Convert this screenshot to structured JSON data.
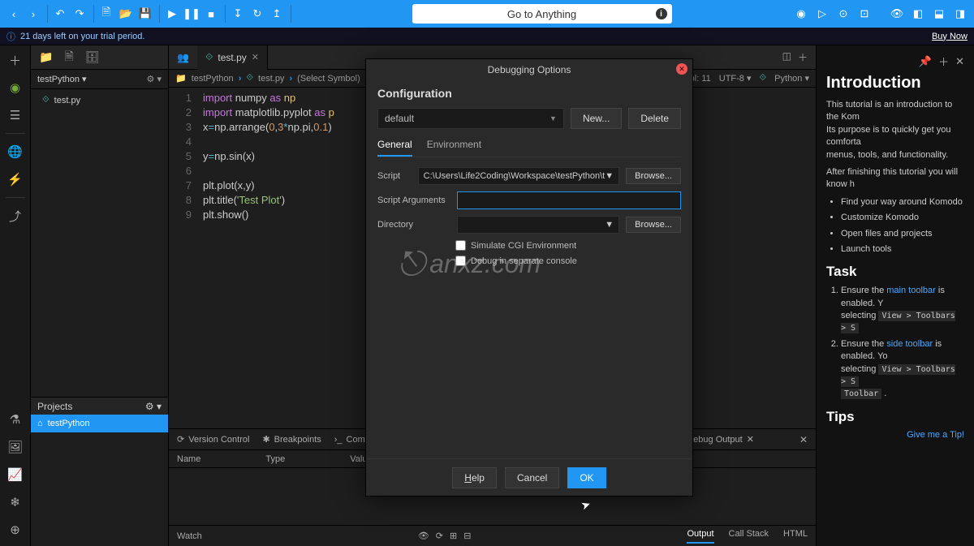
{
  "toolbar": {
    "goto_placeholder": "Go to Anything"
  },
  "trial": {
    "message": "21 days left on your trial period.",
    "buy": "Buy Now"
  },
  "projects": {
    "combo_label": "testPython",
    "tree_item": "test.py",
    "panel_title": "Projects",
    "active_project": "testPython"
  },
  "editor": {
    "tab_label": "test.py",
    "breadcrumb": {
      "folder": "testPython",
      "file": "test.py",
      "symbol": "(Select Symbol)"
    },
    "status": {
      "col": "ol: 11",
      "encoding": "UTF-8",
      "lang": "Python"
    },
    "lines": [
      "1",
      "2",
      "3",
      "4",
      "5",
      "6",
      "7",
      "8",
      "9"
    ],
    "code": [
      {
        "t": "import ",
        "c": "kw"
      },
      {
        "t": "numpy ",
        "c": ""
      },
      {
        "t": "as ",
        "c": "kw"
      },
      {
        "t": "np",
        "c": "mod"
      },
      {
        "br": 1
      },
      {
        "t": "import ",
        "c": "kw"
      },
      {
        "t": "matplotlib.pyplot ",
        "c": ""
      },
      {
        "t": "as ",
        "c": "kw"
      },
      {
        "t": "p",
        "c": "mod"
      },
      {
        "br": 1
      },
      {
        "t": "x",
        "c": ""
      },
      {
        "t": "=",
        "c": "op"
      },
      {
        "t": "np.arrange(",
        "c": ""
      },
      {
        "t": "0",
        "c": "num"
      },
      {
        "t": ",",
        "c": ""
      },
      {
        "t": "3",
        "c": "num"
      },
      {
        "t": "*",
        "c": "op"
      },
      {
        "t": "np.pi,",
        "c": ""
      },
      {
        "t": "0.1",
        "c": "num"
      },
      {
        "t": ")",
        "c": ""
      },
      {
        "br": 1
      },
      {
        "br": 1
      },
      {
        "t": "y",
        "c": ""
      },
      {
        "t": "=",
        "c": "op"
      },
      {
        "t": "np.sin(x)",
        "c": ""
      },
      {
        "br": 1
      },
      {
        "br": 1
      },
      {
        "t": "plt.plot(x,y)",
        "c": ""
      },
      {
        "br": 1
      },
      {
        "t": "plt.title(",
        "c": ""
      },
      {
        "t": "'Test Plot'",
        "c": "str"
      },
      {
        "t": ")",
        "c": ""
      },
      {
        "br": 1
      },
      {
        "t": "plt.show()",
        "c": ""
      }
    ]
  },
  "bottom": {
    "tabs": {
      "vc": "Version Control",
      "bp": "Breakpoints",
      "cmd": "Comma",
      "debug_out": "Debug Output"
    },
    "cols": {
      "name": "Name",
      "type": "Type",
      "value": "Value"
    },
    "watch": "Watch",
    "dtabs": {
      "output": "Output",
      "callstack": "Call Stack",
      "html": "HTML"
    }
  },
  "intro": {
    "h1": "Introduction",
    "p1": "This tutorial is an introduction to the Kom",
    "p1b": "Its purpose is to quickly get you comforta",
    "p1c": "menus, tools, and functionality.",
    "p2": "After finishing this tutorial you will know h",
    "bullets": [
      "Find your way around Komodo",
      "Customize Komodo",
      "Open files and projects",
      "Launch tools"
    ],
    "task_h": "Task",
    "task1a": "Ensure the ",
    "task1_link": "main toolbar",
    "task1b": " is enabled. Y",
    "task1c": "selecting ",
    "task1_code": "View > Toolbars > S",
    "task2a": "Ensure the ",
    "task2_link": "side toolbar",
    "task2b": " is enabled. Yo",
    "task2c": "selecting ",
    "task2_code": "View > Toolbars > S",
    "task2_code2": "Toolbar",
    "tips_h": "Tips",
    "tip_link": "Give me a Tip!"
  },
  "dialog": {
    "title": "Debugging Options",
    "config_h": "Configuration",
    "config_value": "default",
    "new_btn": "New...",
    "delete_btn": "Delete",
    "tab_general": "General",
    "tab_env": "Environment",
    "lbl_script": "Script",
    "val_script": "C:\\Users\\Life2Coding\\Workspace\\testPython\\t",
    "lbl_args": "Script Arguments",
    "lbl_dir": "Directory",
    "browse": "Browse...",
    "chk_cgi": "Simulate CGI Environment",
    "chk_console": "Debug in separate console",
    "help": "Help",
    "cancel": "Cancel",
    "ok": "OK"
  },
  "watermark": "anxz.com"
}
